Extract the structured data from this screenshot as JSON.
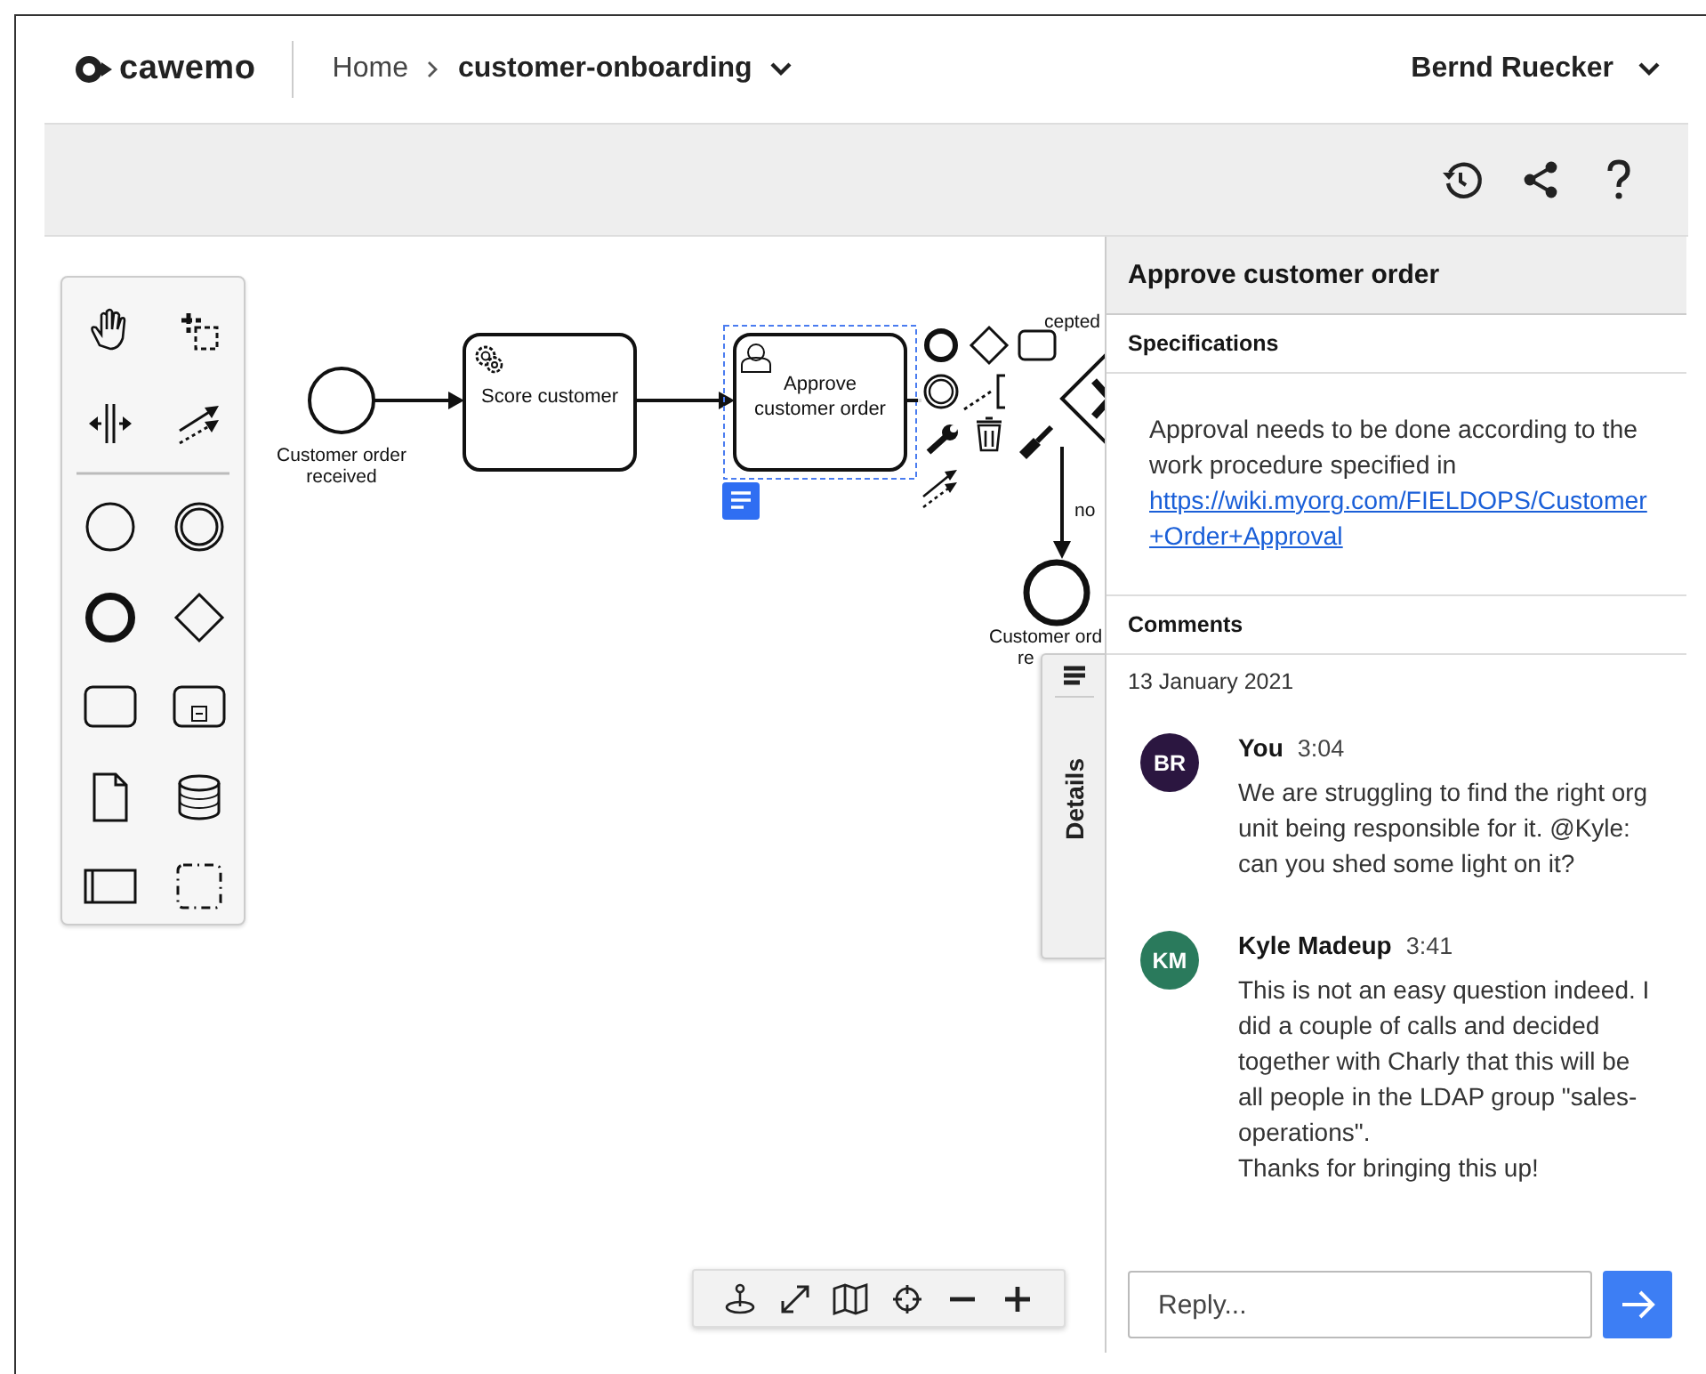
{
  "header": {
    "logo": "cawemo",
    "breadcrumb": [
      {
        "label": "Home",
        "kind": "link"
      },
      {
        "label": "customer-onboarding",
        "kind": "current"
      }
    ],
    "user": "Bernd Ruecker"
  },
  "diagram": {
    "start_event": {
      "label": [
        "Customer order",
        "received"
      ]
    },
    "tasks": [
      {
        "kind": "service",
        "label": [
          "Score customer"
        ],
        "selected": false
      },
      {
        "kind": "user",
        "label": [
          "Approve",
          "customer order"
        ],
        "selected": true
      }
    ],
    "gateway_label": "cepted",
    "flow_label": "no",
    "end_event": {
      "label": [
        "Customer ord",
        "re"
      ]
    }
  },
  "details_tab": {
    "label": "Details"
  },
  "panel": {
    "title": "Approve customer order",
    "specifications": {
      "heading": "Specifications",
      "text": "Approval needs to be done according to the work procedure specified in",
      "link": "https://wiki.myorg.com/FIELDOPS/Customer+Order+Approval"
    },
    "comments": {
      "heading": "Comments",
      "date": "13 January 2021",
      "items": [
        {
          "initials": "BR",
          "color": "#2b1640",
          "author": "You",
          "time": "3:04",
          "text": "We are struggling to find the right org unit being responsible for it. @Kyle: can you shed some light on it?"
        },
        {
          "initials": "KM",
          "color": "#2a7a5c",
          "author": "Kyle Madeup",
          "time": "3:41",
          "text": "This is not an easy question indeed. I did a couple of calls and decided together with Charly that this will be all people in the LDAP group \"sales-operations\".\nThanks for bringing this up!"
        }
      ]
    },
    "reply": {
      "placeholder": "Reply..."
    }
  }
}
